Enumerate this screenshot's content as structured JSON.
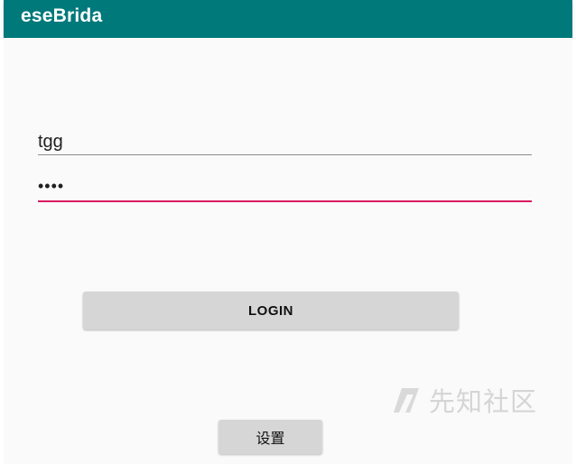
{
  "app": {
    "title": "eseBrida"
  },
  "form": {
    "username_value": "tgg",
    "password_value": "••••",
    "login_label": "LOGIN",
    "settings_label": "设置"
  },
  "watermark": {
    "text": "先知社区",
    "logo_icon": "xianzhi-logo-icon"
  },
  "colors": {
    "app_bar": "#00797b",
    "focused_underline": "#d81b60",
    "button_background": "#d6d6d6"
  }
}
